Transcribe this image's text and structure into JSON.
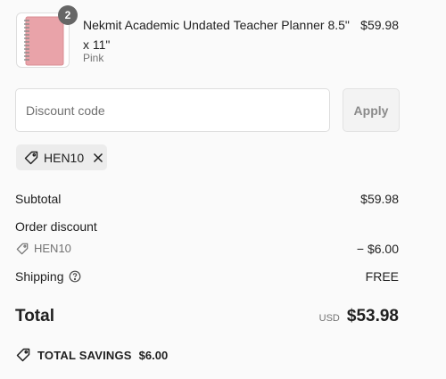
{
  "line_item": {
    "quantity": "2",
    "title": "Nekmit Academic Undated Teacher Planner 8.5\" x 11\"",
    "variant": "Pink",
    "price": "$59.98",
    "image_icon": "pink-planner-thumbnail"
  },
  "discount_form": {
    "placeholder": "Discount code",
    "value": "",
    "apply_label": "Apply"
  },
  "applied_code": {
    "code": "HEN10",
    "tag_icon": "tag-icon",
    "remove_icon": "close-icon"
  },
  "summary": {
    "subtotal_label": "Subtotal",
    "subtotal_value": "$59.98",
    "order_discount_label": "Order discount",
    "discount_code": "HEN10",
    "discount_value": "− $6.00",
    "shipping_label": "Shipping",
    "shipping_value": "FREE",
    "shipping_help_icon": "question-circle-icon",
    "total_label": "Total",
    "currency": "USD",
    "total_value": "$53.98"
  },
  "savings": {
    "label": "TOTAL SAVINGS",
    "amount": "$6.00",
    "icon": "tag-icon"
  },
  "colors": {
    "planner_pink": "#e9a3a9",
    "badge_gray": "#666666",
    "chip_bg": "#ececec"
  }
}
